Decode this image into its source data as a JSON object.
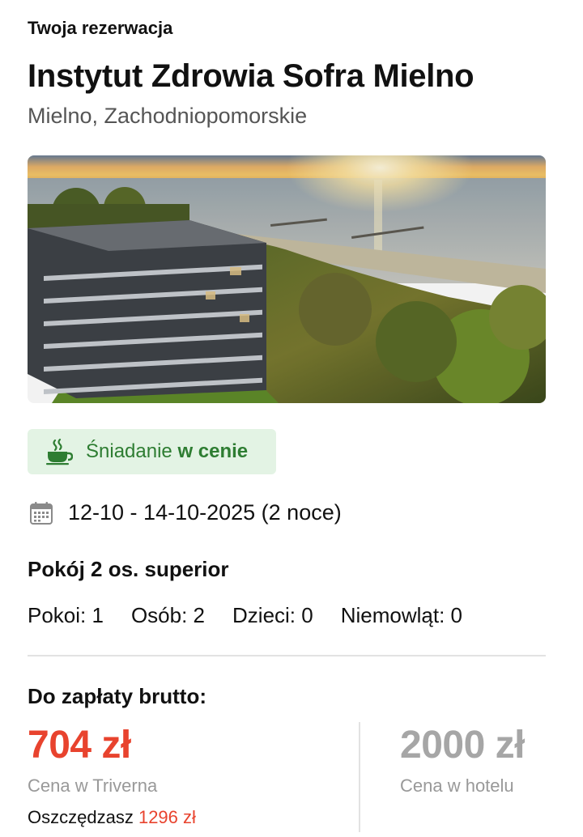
{
  "header": {
    "eyebrow": "Twoja rezerwacja",
    "hotel_name": "Instytut Zdrowia Sofra Mielno",
    "location": "Mielno, Zachodniopomorskie"
  },
  "hero": {
    "image_subject": "hotel-building-by-sea-at-sunset"
  },
  "breakfast": {
    "icon": "coffee-cup-icon",
    "text_regular": "Śniadanie",
    "text_bold": "w cenie",
    "color": "#2e7d32",
    "background": "#e3f3e4"
  },
  "stay": {
    "icon": "calendar-icon",
    "dates": "12-10 - 14-10-2025 (2 noce)",
    "room_type": "Pokój 2 os. superior",
    "occupancy": [
      "Pokoi: 1",
      "Osób: 2",
      "Dzieci: 0",
      "Niemowląt: 0"
    ]
  },
  "payment": {
    "label": "Do zapłaty brutto:",
    "our_price": "704 zł",
    "our_price_caption": "Cena w Triverna",
    "hotel_price": "2000 zł",
    "hotel_price_caption": "Cena w hotelu",
    "savings_prefix": "Oszczędzasz",
    "savings_amount": "1296 zł",
    "accent_color": "#e8432e"
  }
}
